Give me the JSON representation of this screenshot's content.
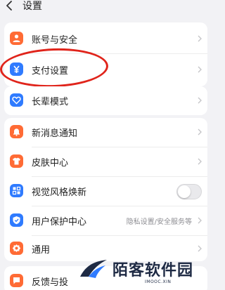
{
  "header": {
    "title": "设置",
    "back_icon": "chevron-left-icon"
  },
  "group1": {
    "items": [
      {
        "label": "账号与安全",
        "icon": "account-security-icon",
        "icon_color": "#ff6b35"
      },
      {
        "label": "支付设置",
        "icon": "yuan-icon",
        "icon_color": "#2f7bff"
      }
    ]
  },
  "group2": {
    "items": [
      {
        "label": "长辈模式",
        "icon": "heart-elder-icon",
        "icon_color": "#2f7bff"
      }
    ]
  },
  "group3": {
    "items": [
      {
        "label": "新消息通知",
        "icon": "bell-icon",
        "icon_color": "#ff6b35"
      },
      {
        "label": "皮肤中心",
        "icon": "shirt-icon",
        "icon_color": "#ff6b35"
      },
      {
        "label": "视觉风格焕新",
        "icon": "style-refresh-icon",
        "icon_color": "#2f7bff",
        "toggle_on": false
      },
      {
        "label": "用户保护中心",
        "icon": "shield-check-icon",
        "icon_color": "#2f7bff",
        "value": "隐私设置/安全服务等"
      },
      {
        "label": "通用",
        "icon": "gear-icon",
        "icon_color": "#ff6b35"
      }
    ]
  },
  "group4": {
    "items": [
      {
        "label": "反馈与投",
        "icon": "feedback-icon",
        "icon_color": "#ff6b35"
      }
    ]
  },
  "annotation": {
    "color": "#e0241b"
  },
  "watermark": {
    "text": "陌客软件园",
    "sub": "IMOOC.XIN"
  }
}
